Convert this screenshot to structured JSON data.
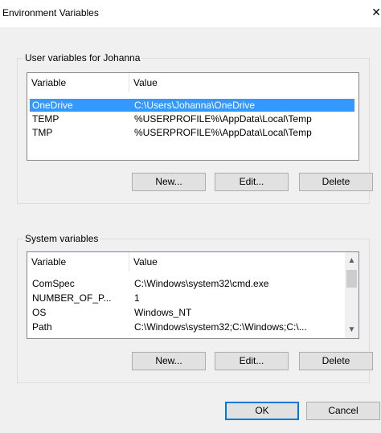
{
  "window": {
    "title": "Environment Variables"
  },
  "user_group": {
    "legend": "User variables for Johanna",
    "columns": [
      "Variable",
      "Value"
    ],
    "rows": [
      {
        "variable": "OneDrive",
        "value": "C:\\Users\\Johanna\\OneDrive"
      },
      {
        "variable": "TEMP",
        "value": "%USERPROFILE%\\AppData\\Local\\Temp"
      },
      {
        "variable": "TMP",
        "value": "%USERPROFILE%\\AppData\\Local\\Temp"
      }
    ],
    "buttons": {
      "new": "New...",
      "edit": "Edit...",
      "delete": "Delete"
    }
  },
  "system_group": {
    "legend": "System variables",
    "columns": [
      "Variable",
      "Value"
    ],
    "rows": [
      {
        "variable": "ComSpec",
        "value": "C:\\Windows\\system32\\cmd.exe"
      },
      {
        "variable": "NUMBER_OF_P...",
        "value": "1"
      },
      {
        "variable": "OS",
        "value": "Windows_NT"
      },
      {
        "variable": "Path",
        "value": "C:\\Windows\\system32;C:\\Windows;C:\\..."
      }
    ],
    "buttons": {
      "new": "New...",
      "edit": "Edit...",
      "delete": "Delete"
    }
  },
  "dialog_buttons": {
    "ok": "OK",
    "cancel": "Cancel"
  },
  "icons": {
    "close": "close-icon",
    "scroll_up": "chevron-up-icon",
    "scroll_down": "chevron-down-icon"
  },
  "colors": {
    "selection": "#3399ff",
    "default_button_border": "#0078d7"
  }
}
